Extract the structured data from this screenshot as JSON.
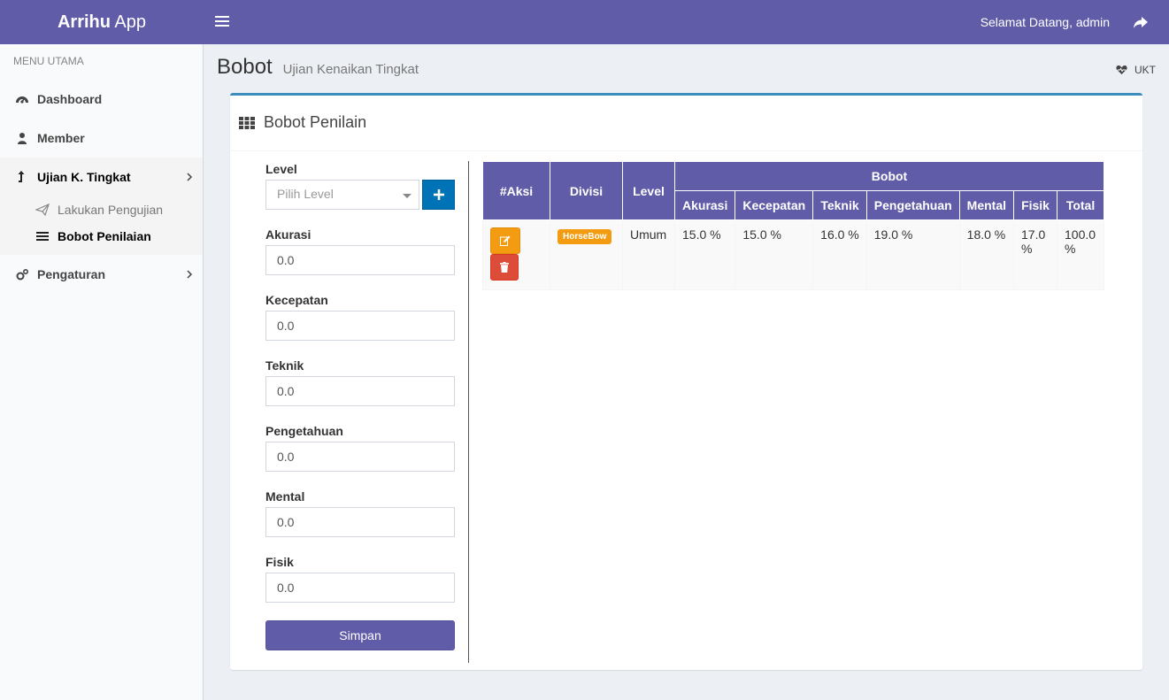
{
  "app": {
    "logo_bold": "Arrihu",
    "logo_light": "App"
  },
  "topbar": {
    "welcome": "Selamat Datang, admin"
  },
  "sidebar": {
    "header": "MENU UTAMA",
    "items": [
      {
        "label": "Dashboard",
        "icon": "dashboard-icon"
      },
      {
        "label": "Member",
        "icon": "user-icon"
      },
      {
        "label": "Ujian K. Tingkat",
        "icon": "level-up-icon"
      },
      {
        "label": "Pengaturan",
        "icon": "cogs-icon"
      }
    ],
    "subitems": [
      {
        "label": "Lakukan Pengujian",
        "icon": "paper-plane-icon"
      },
      {
        "label": "Bobot Penilaian",
        "icon": "list-icon"
      }
    ]
  },
  "page": {
    "title": "Bobot",
    "subtitle": "Ujian Kenaikan Tingkat",
    "breadcrumb": "UKT"
  },
  "box": {
    "title": "Bobot Penilain"
  },
  "form": {
    "level_label": "Level",
    "level_placeholder": "Pilih Level",
    "fields": [
      {
        "label": "Akurasi",
        "value": "0.0"
      },
      {
        "label": "Kecepatan",
        "value": "0.0"
      },
      {
        "label": "Teknik",
        "value": "0.0"
      },
      {
        "label": "Pengetahuan",
        "value": "0.0"
      },
      {
        "label": "Mental",
        "value": "0.0"
      },
      {
        "label": "Fisik",
        "value": "0.0"
      }
    ],
    "save_label": "Simpan"
  },
  "table": {
    "headers": {
      "aksi": "#Aksi",
      "divisi": "Divisi",
      "level": "Level",
      "bobot": "Bobot"
    },
    "subheaders": [
      "Akurasi",
      "Kecepatan",
      "Teknik",
      "Pengetahuan",
      "Mental",
      "Fisik",
      "Total"
    ],
    "rows": [
      {
        "divisi": "HorseBow",
        "level": "Umum",
        "values": [
          "15.0 %",
          "15.0 %",
          "16.0 %",
          "19.0 %",
          "18.0 %",
          "17.0 %",
          "100.0 %"
        ]
      }
    ]
  },
  "colors": {
    "primary": "#605ca8",
    "blue": "#0073b7",
    "warning": "#f39c12",
    "danger": "#dd4b39",
    "box_border": "#3c8dbc"
  }
}
